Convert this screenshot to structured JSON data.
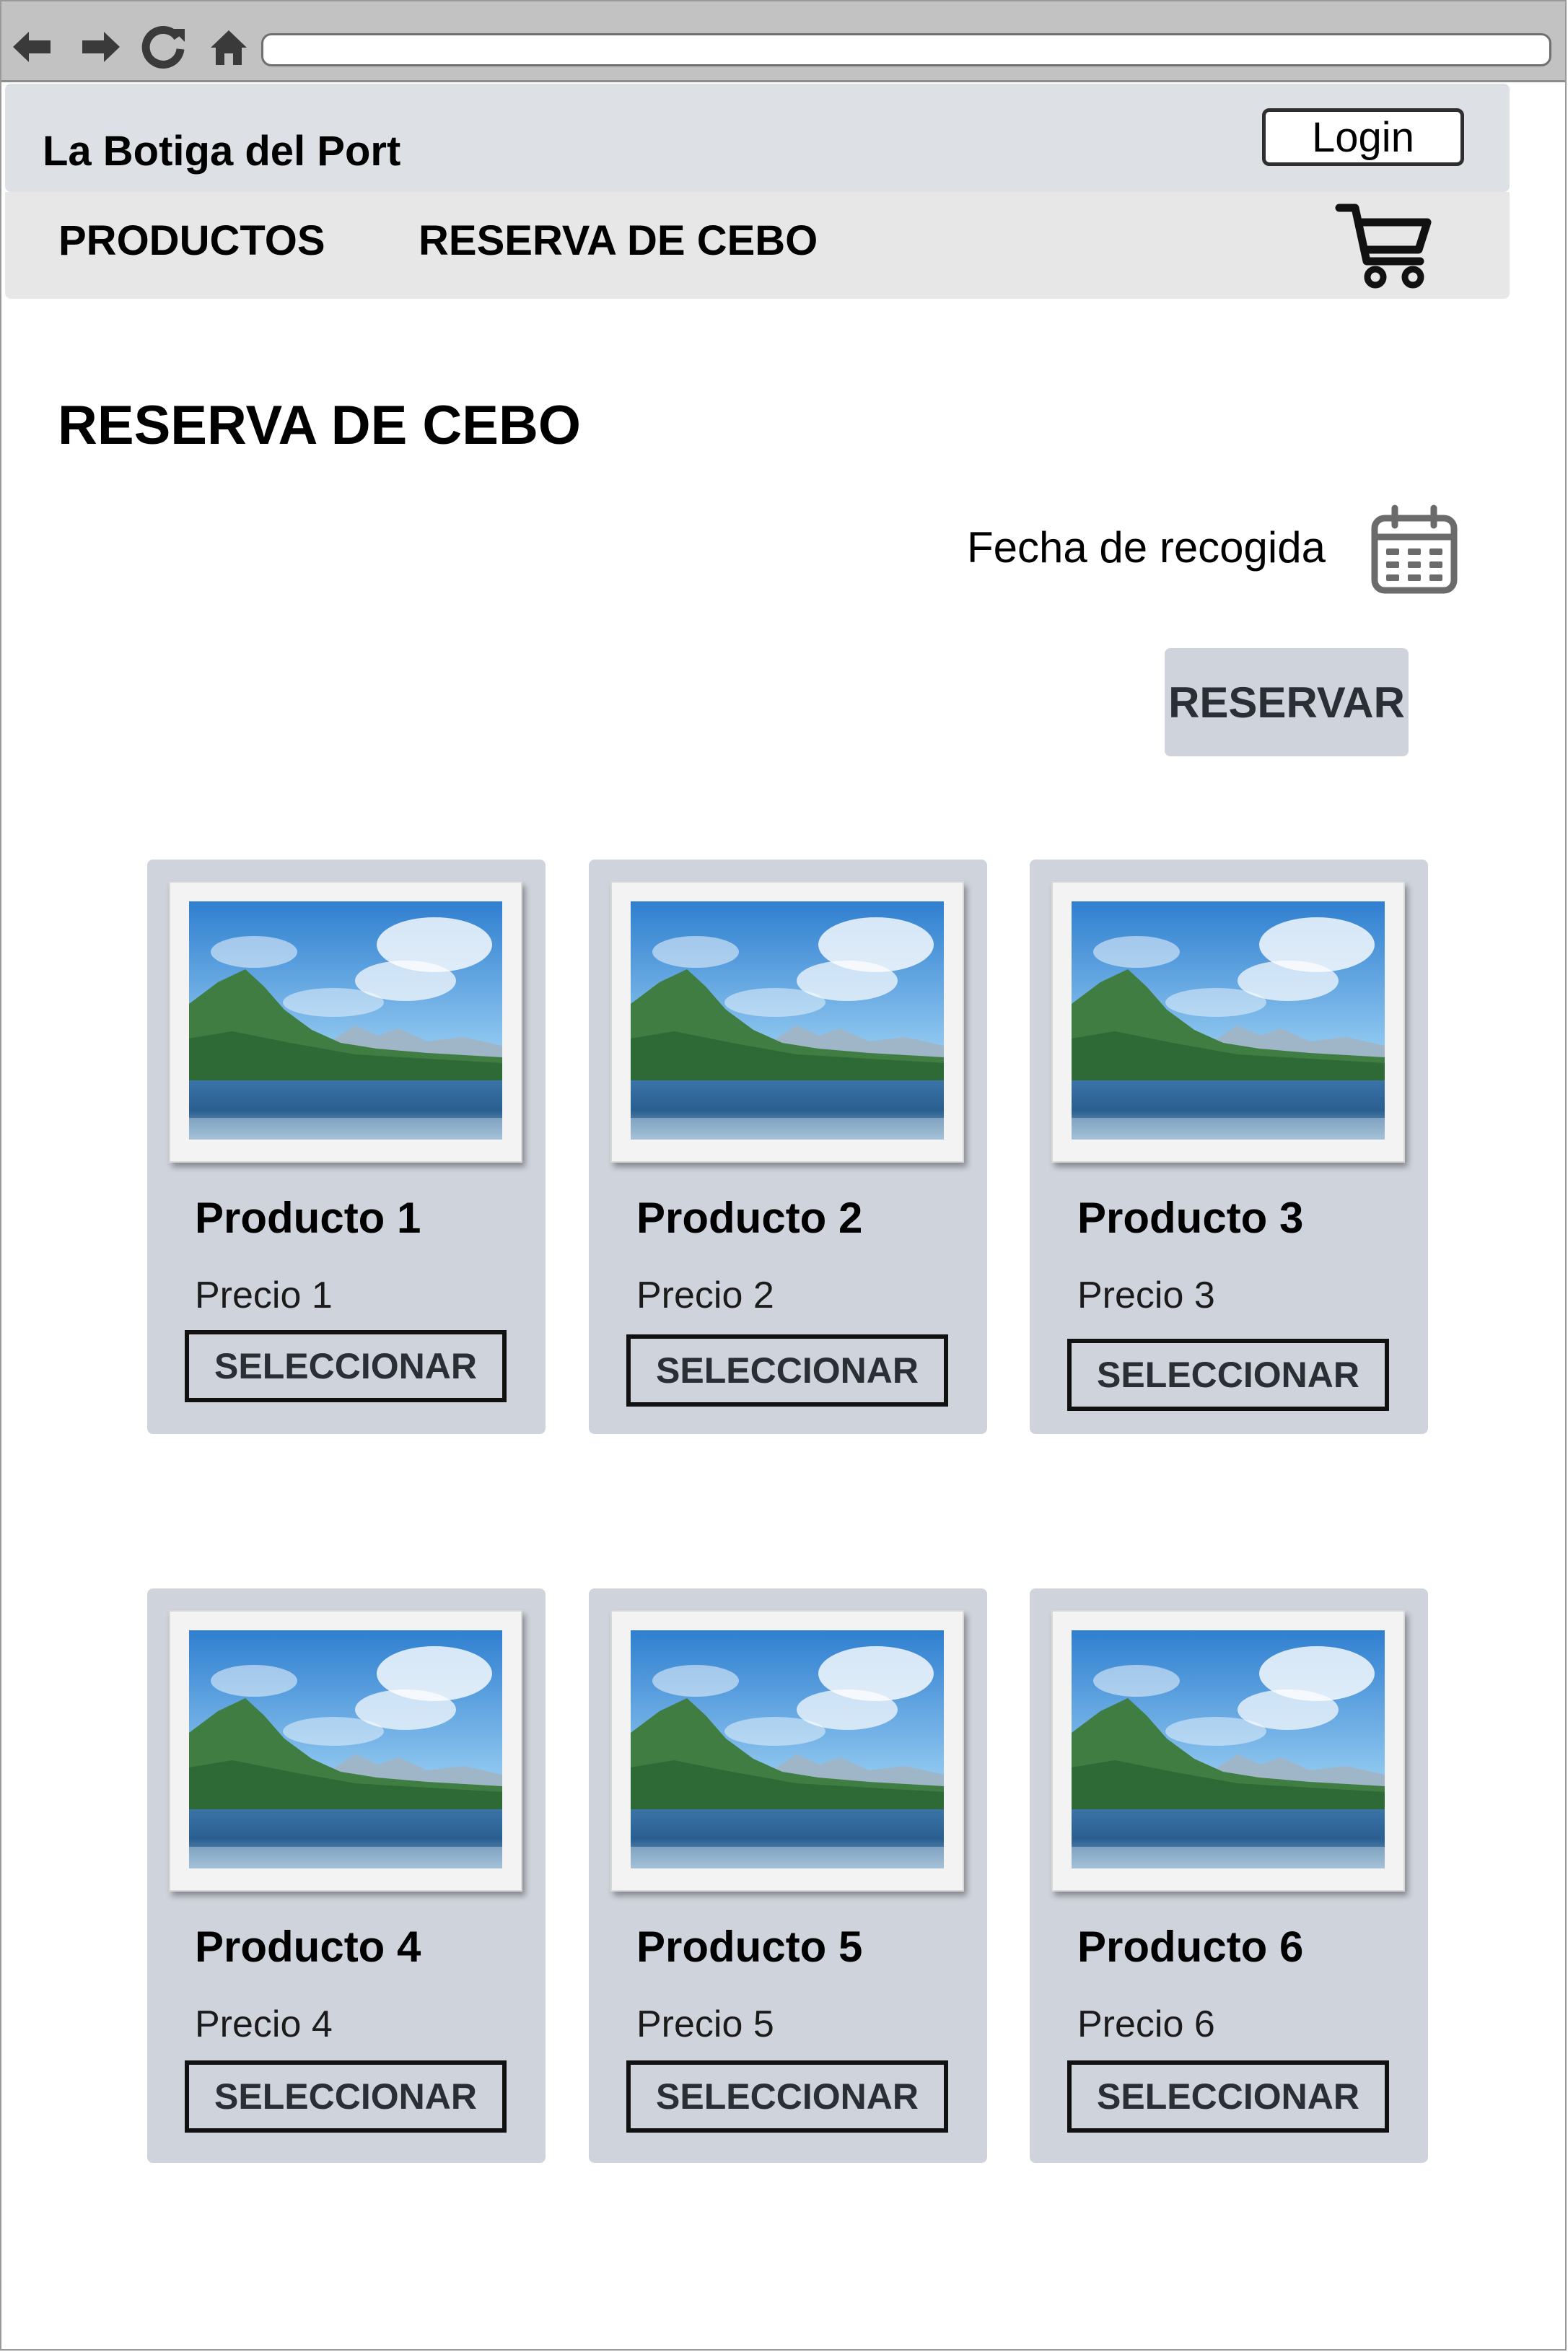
{
  "browser": {
    "url": ""
  },
  "header": {
    "brand": "La Botiga del Port",
    "login_label": "Login"
  },
  "nav": {
    "items": [
      {
        "label": "PRODUCTOS"
      },
      {
        "label": "RESERVA DE CEBO"
      }
    ]
  },
  "page": {
    "title": "RESERVA DE CEBO",
    "date_label": "Fecha de recogida",
    "reserve_label": "RESERVAR"
  },
  "products": [
    {
      "name": "Producto 1",
      "price": "Precio 1",
      "button": "SELECCIONAR"
    },
    {
      "name": "Producto 2",
      "price": "Precio 2",
      "button": "SELECCIONAR"
    },
    {
      "name": "Producto 3",
      "price": "Precio 3",
      "button": "SELECCIONAR"
    },
    {
      "name": "Producto 4",
      "price": "Precio 4",
      "button": "SELECCIONAR"
    },
    {
      "name": "Producto 5",
      "price": "Precio 5",
      "button": "SELECCIONAR"
    },
    {
      "name": "Producto 6",
      "price": "Precio 6",
      "button": "SELECCIONAR"
    }
  ],
  "icons": {
    "back": "arrow-left-icon",
    "forward": "arrow-right-icon",
    "reload": "reload-icon",
    "home": "home-icon",
    "cart": "cart-icon",
    "calendar": "calendar-icon",
    "image": "landscape-image-icon"
  },
  "colors": {
    "card_bg": "#cfd4dc",
    "header_bg": "#dde1e6",
    "nav_bg": "#e7e7e7",
    "chrome_bg": "#c2c2c2"
  }
}
